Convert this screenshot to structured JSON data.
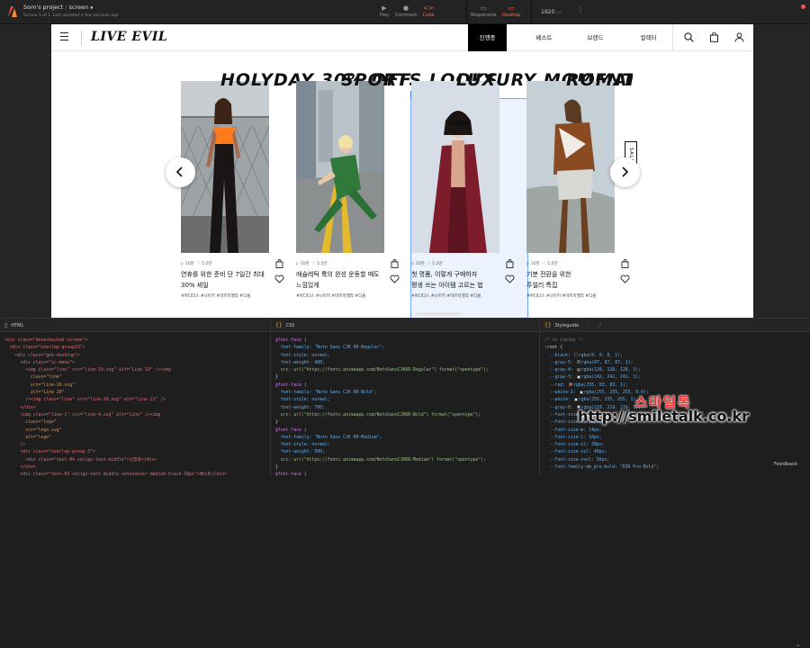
{
  "app": {
    "project_title": "Som's project",
    "screen_name": "screen",
    "subtitle": "Screen 1 of 1. Last updated a few seconds ago",
    "modes": [
      "Play",
      "Comment",
      "Code"
    ],
    "active_mode": "Code",
    "devices": [
      "Responsive",
      "Desktop"
    ],
    "active_device": "Desktop",
    "width_value": "1920",
    "width_unit": "px",
    "accent": "#ff6a4d"
  },
  "site": {
    "brand": "LIVE EVIL",
    "nav_tabs": [
      "진행중",
      "베스트",
      "브랜드",
      "컬렉터"
    ],
    "active_tab": "진행중",
    "icons": [
      "hamburger-icon",
      "search-icon",
      "bag-icon",
      "user-icon"
    ],
    "selection_label": "article",
    "sale_badge": "SALE",
    "slides": [
      {
        "heading": "HOLYDAY\n30% OFF",
        "stat_views": "10만",
        "stat_likes": "5.2만",
        "title": "연휴를 위한 준비 단 7일간 최대\n30% 세일",
        "tags": "#아디다스  #나이키  #마르지엘라  #디올"
      },
      {
        "heading": "SPORTS\nLOOKS",
        "stat_views": "10만",
        "stat_likes": "5.2만",
        "title": "애슬레틱 룩의 완성 운동할 때도\n느낌있게",
        "tags": "#아디다스  #나이키  #마르지엘라  #디올"
      },
      {
        "heading": "LUXURY\nMOMENT",
        "stat_views": "10만",
        "stat_likes": "5.2만",
        "title": "첫 명품, 이렇게 구매하자\n평생 쓰는 아이템 고르는 법",
        "tags": "#아디다스  #나이키  #마르지엘라  #디올"
      },
      {
        "heading": "ROMAN\nJEW",
        "stat_views": "10만",
        "stat_likes": "5.2만",
        "title": "기분 전환을 위한\n주얼리 특집",
        "tags": "#아디다스  #나이키  #마르지엘라  #디올"
      }
    ]
  },
  "panels": {
    "html_title": "HTML",
    "css_title": "CSS",
    "styleguide_title": "Styleguide",
    "feedback": "Feedback",
    "html_lines": [
      "<div class=\"desexkeutab screen\">",
      "  <div class=\"overlap-group13\">",
      "    <div class=\"gnb-desktop\">",
      "      <div class=\"ic-menu\">",
      "        <img class=\"line\" src=\"line-19.svg\" alt=\"Line 19\" /><img",
      "          class=\"line\"",
      "          src=\"line-19.svg\"",
      "          alt=\"Line 20\"",
      "        /><img class=\"line\" src=\"line-19.svg\" alt=\"Line 21\" />",
      "      </div>",
      "      <img class=\"line-1\" src=\"line-4.svg\" alt=\"Line\" /><img",
      "        class=\"logo\"",
      "        src=\"logo.svg\"",
      "        alt=\"logo\"",
      "      />",
      "      <div class=\"overlap-group-3\">",
      "        <div class=\"text-84 valign-text-middle\">진행중</div>",
      "      </div>",
      "      <div class=\"text-83 valign-text-middle notosanskr-medium-black-18px\">베스트</div>",
      "      <div class=\"overlap-group1\">",
      "        <div class=\"text-8 valign-text-middle notosanskr-medium-black-18px\">브랜드</div>"
    ],
    "css_lines": [
      "@font-face {",
      "  font-family: \"Noto Sans CJK KR-Regular\";",
      "  font-style: normal;",
      "  font-weight: 400;",
      "  src: url(\"https://fonts.animaapp.com/NotoSansCJKKR-Regular\") format(\"opentype\");",
      "}",
      "",
      "@font-face {",
      "  font-family: \"Noto Sans CJK KR-Bold\";",
      "  font-style: normal;",
      "  font-weight: 700;",
      "  src: url(\"https://fonts.animaapp.com/NotoSansCJKKR-Bold\") format(\"opentype\");",
      "}",
      "",
      "@font-face {",
      "  font-family: \"Noto Sans CJK KR-Medium\";",
      "  font-style: normal;",
      "  font-weight: 500;",
      "  src: url(\"https://fonts.animaapp.com/NotoSansCJKKR-Medium\") format(\"opentype\");",
      "}",
      "",
      "@font-face {"
    ],
    "style_lines": [
      "/* to Lnpley */",
      "",
      ":root {",
      "  --black: rgba(0, 0, 0, 1);",
      "  --gray-5: rgba(87, 87, 87, 1);",
      "  --gray-4: rgba(128, 128, 128, 1);",
      "  --gray-3: rgba(242, 242, 242, 1);",
      "  --red: rgba(255, 83, 83, 1);",
      "  --white-2: rgba(255, 255, 255, 0.6);",
      "  --white: rgba(255, 255, 255, 1);",
      "  --gray-8: rgba(219, 219, 219, 1);",
      "",
      "  --font-size-xs: 10px;",
      "  --font-size-s: 12px;",
      "  --font-size-m: 14px;",
      "  --font-size-l: 18px;",
      "  --font-size-xl: 30px;",
      "  --font-size-xxl: 40px;",
      "  --font-size-xxxl: 56px;",
      "",
      "  --font-family-dm_pro-bold: \"DIN Pro-Bold\";"
    ],
    "style_swatches": [
      "#000000",
      "#575757",
      "#808080",
      "#f2f2f2",
      "#ff5353",
      "#ffffff",
      "#ffffff",
      "#dbdbdb"
    ]
  },
  "watermark": {
    "korean": "스마일톡",
    "url": "http://smiletalk.co.kr"
  }
}
